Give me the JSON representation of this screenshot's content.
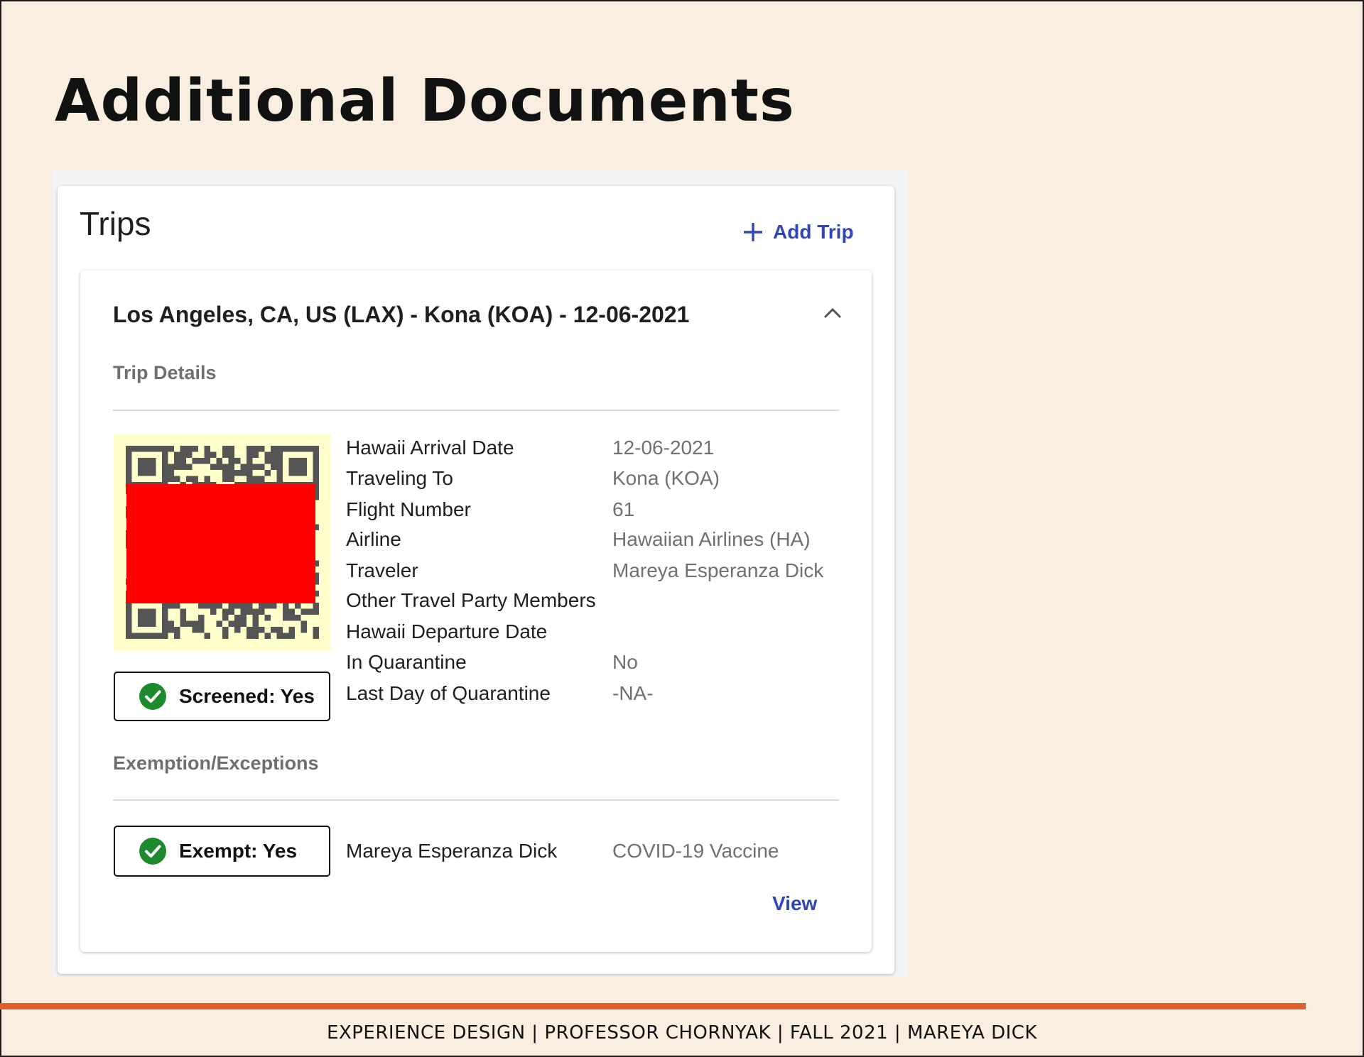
{
  "page": {
    "title": "Additional Documents",
    "footer": "EXPERIENCE DESIGN | PROFESSOR CHORNYAK | FALL 2021 | MAREYA DICK"
  },
  "trips": {
    "title": "Trips",
    "add_label": "Add Trip",
    "trip": {
      "header": "Los Angeles, CA, US (LAX) - Kona (KOA) - 12-06-2021",
      "details_label": "Trip Details",
      "screened_label": "Screened: Yes",
      "details": [
        {
          "label": "Hawaii Arrival Date",
          "value": "12-06-2021"
        },
        {
          "label": "Traveling To",
          "value": "Kona (KOA)"
        },
        {
          "label": "Flight Number",
          "value": "61"
        },
        {
          "label": "Airline",
          "value": "Hawaiian Airlines (HA)"
        },
        {
          "label": "Traveler",
          "value": "Mareya Esperanza Dick"
        },
        {
          "label": "Other Travel Party Members",
          "value": ""
        },
        {
          "label": "Hawaii Departure Date",
          "value": ""
        },
        {
          "label": "In Quarantine",
          "value": "No"
        },
        {
          "label": "Last Day of Quarantine",
          "value": "-NA-"
        }
      ],
      "exemption_label": "Exemption/Exceptions",
      "exempt_label": "Exempt: Yes",
      "exempt_person": "Mareya Esperanza Dick",
      "exempt_reason": "COVID-19 Vaccine",
      "view_label": "View"
    }
  },
  "colors": {
    "background": "#faeee0",
    "link": "#2f46b8",
    "check": "#1e8a2e",
    "accent_rule": "#e0602a",
    "redaction": "#ff0000",
    "qr_background": "#ffffcc"
  },
  "icons": {
    "add": "plus-icon",
    "collapse": "chevron-up-icon",
    "status": "check-circle-icon"
  }
}
